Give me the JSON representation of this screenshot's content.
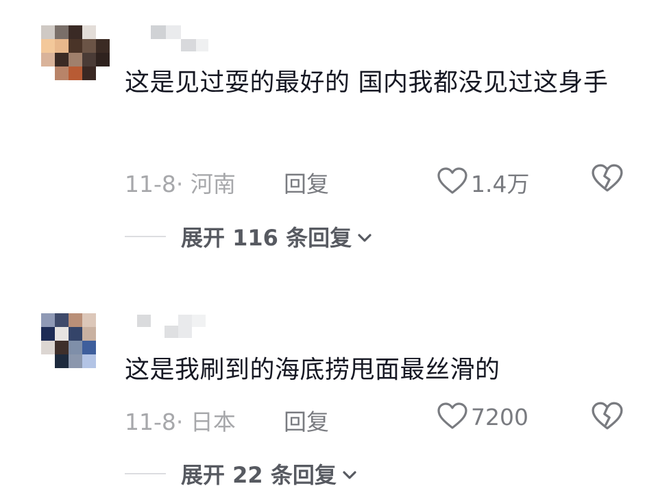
{
  "comments": [
    {
      "content": "这是见过耍的最好的 国内我都没见过这身手",
      "date_location": "11-8· 河南",
      "reply_label": "回复",
      "like_count": "1.4万",
      "expand_label": "展开 116 条回复",
      "avatar_colors": [
        "#cfc9c4",
        "#7a6f69",
        "#3a2a25",
        "#e3ddd8",
        "#ffffff",
        "#f3c89a",
        "#e8b88c",
        "#4a3428",
        "#6b5446",
        "#3b2b24",
        "#d9b39a",
        "#3b2a24",
        "#a0806c",
        "#4a3b36",
        "#2f221e",
        "#ffffff",
        "#b88469",
        "#b85b34",
        "#3a2823",
        "#ffffff",
        "#ffffff",
        "#ffffff",
        "#ffffff",
        "#ffffff",
        "#ffffff"
      ]
    },
    {
      "content": "这是我刷到的海底捞甩面最丝滑的",
      "date_location": "11-8· 日本",
      "reply_label": "回复",
      "like_count": "7200",
      "expand_label": "展开 22 条回复",
      "avatar_colors": [
        "#8f99b5",
        "#3f4a6a",
        "#b98f78",
        "#dcc7b9",
        "#ffffff",
        "#1d2b55",
        "#e7e3e1",
        "#344469",
        "#c9b1a1",
        "#ffffff",
        "#dcd6d2",
        "#3e2f2b",
        "#7f8fa9",
        "#3e5e9c",
        "#ffffff",
        "#ffffff",
        "#1d2a3d",
        "#8b97ad",
        "#b3c4e5",
        "#ffffff",
        "#ffffff",
        "#ffffff",
        "#ffffff",
        "#ffffff",
        "#ffffff"
      ]
    }
  ],
  "icons": {
    "like": "heart-outline-icon",
    "dislike": "broken-heart-icon",
    "expand": "chevron-down-icon"
  },
  "colors": {
    "text_primary": "#161823",
    "text_secondary": "#a7a8ab",
    "text_action": "#797b80",
    "expand_text": "#575a61"
  }
}
